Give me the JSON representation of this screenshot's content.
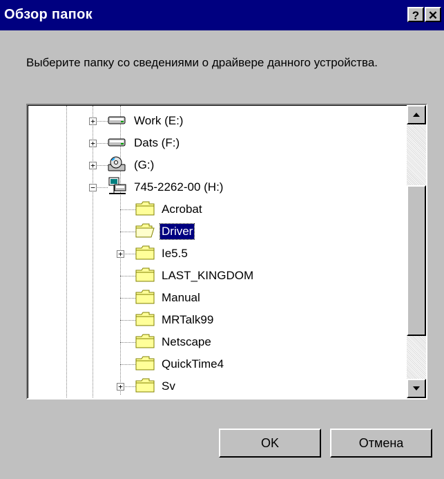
{
  "window": {
    "title": "Обзор папок",
    "help_button": "?",
    "close_button": "✕"
  },
  "prompt": "Выберите папку со сведениями о драйвере данного устройства.",
  "tree": {
    "items": [
      {
        "label": "Work (E:)",
        "icon": "hard-drive-icon",
        "expander": "+"
      },
      {
        "label": "Dats (F:)",
        "icon": "hard-drive-icon",
        "expander": "+"
      },
      {
        "label": "(G:)",
        "icon": "cd-drive-icon",
        "expander": "+"
      },
      {
        "label": "745-2262-00 (H:)",
        "icon": "network-drive-icon",
        "expander": "−"
      },
      {
        "label": "Acrobat",
        "icon": "folder-icon"
      },
      {
        "label": "Driver",
        "icon": "folder-open-icon",
        "selected": true
      },
      {
        "label": "Ie5.5",
        "icon": "folder-icon",
        "expander": "+"
      },
      {
        "label": "LAST_KINGDOM",
        "icon": "folder-icon"
      },
      {
        "label": "Manual",
        "icon": "folder-icon"
      },
      {
        "label": "MRTalk99",
        "icon": "folder-icon"
      },
      {
        "label": "Netscape",
        "icon": "folder-icon"
      },
      {
        "label": "QuickTime4",
        "icon": "folder-icon"
      },
      {
        "label": "Sv",
        "icon": "folder-icon",
        "expander": "+"
      }
    ]
  },
  "buttons": {
    "ok": "OK",
    "cancel": "Отмена"
  },
  "colors": {
    "titlebar": "#000080",
    "face": "#c0c0c0",
    "selection": "#000080",
    "folder": "#ffff99"
  }
}
